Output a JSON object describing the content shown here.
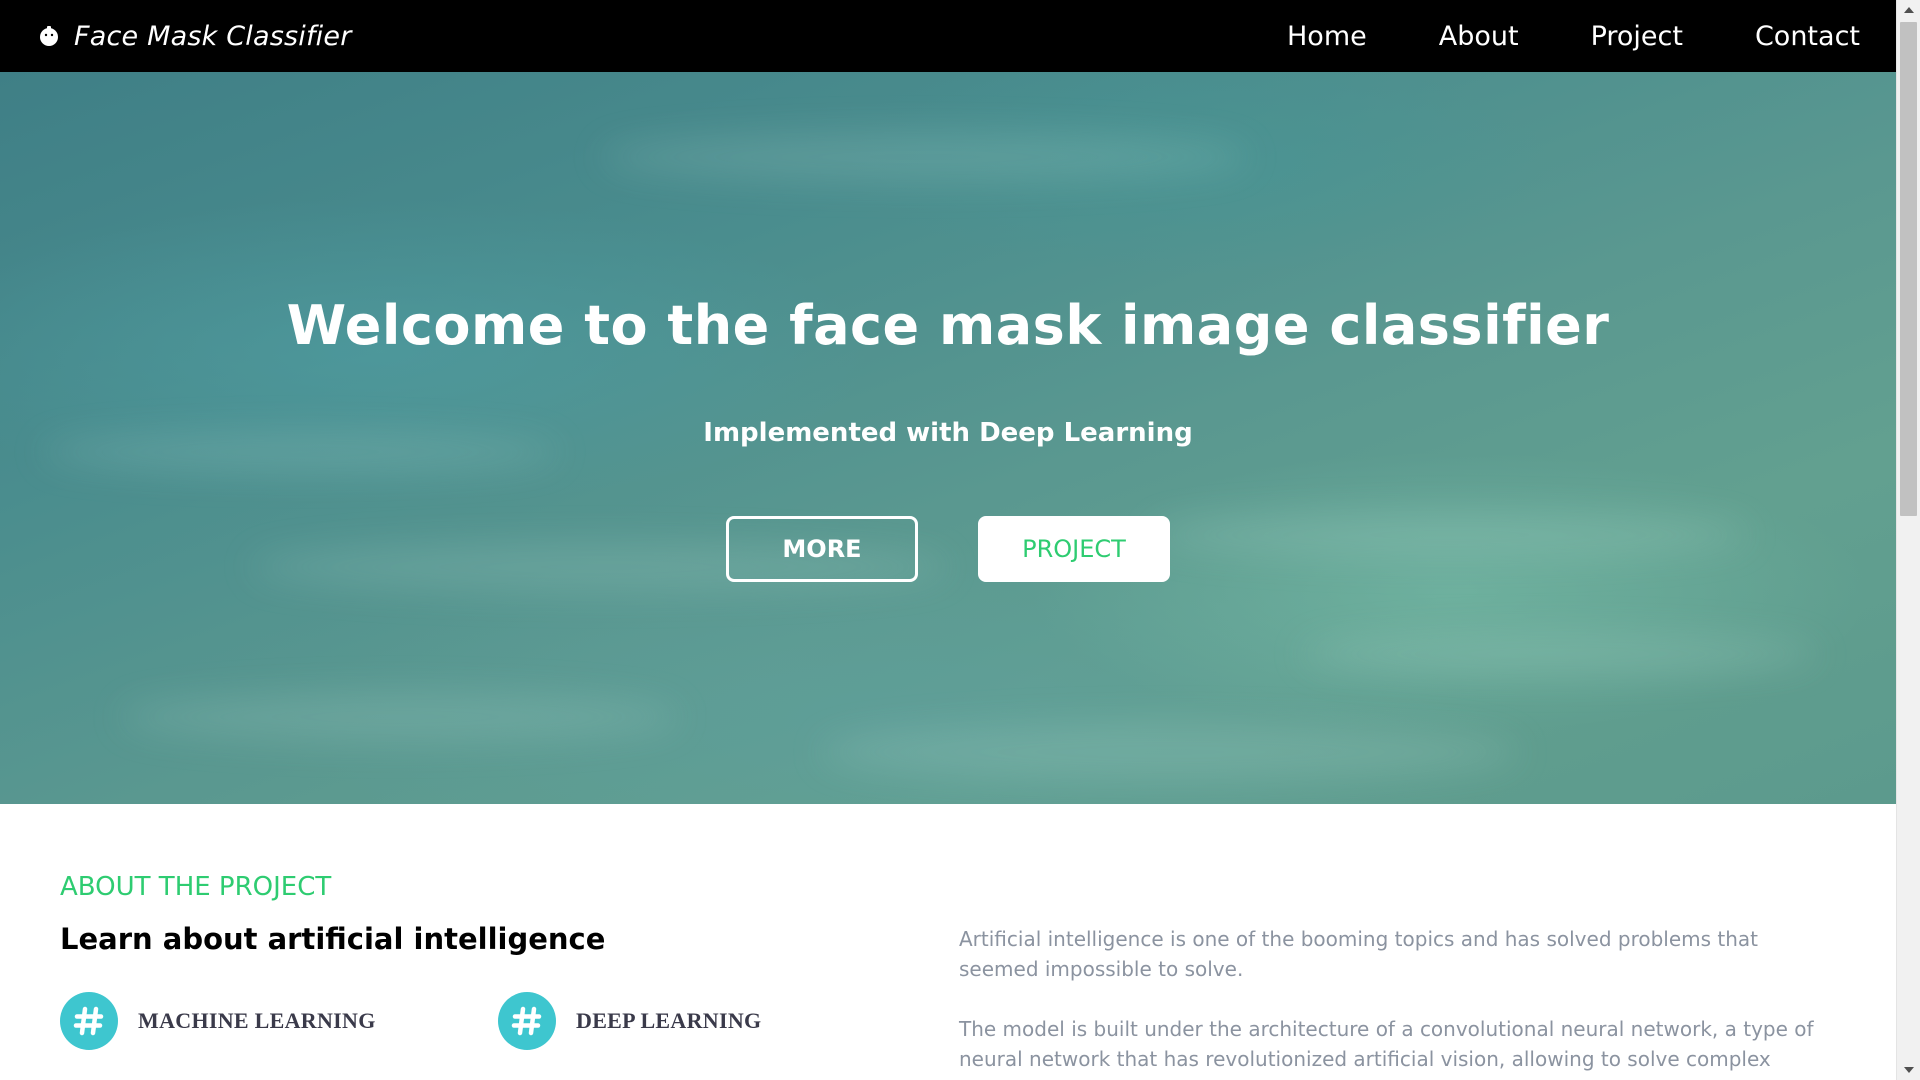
{
  "navbar": {
    "brand": "Face Mask Classifier",
    "brand_icon": "face-mask-icon",
    "links": [
      "Home",
      "About",
      "Project",
      "Contact"
    ]
  },
  "hero": {
    "title": "Welcome to the face mask image classifier",
    "subtitle": "Implemented with Deep Learning",
    "buttons": {
      "more": "MORE",
      "project": "PROJECT"
    }
  },
  "about": {
    "eyebrow": "ABOUT THE PROJECT",
    "heading": "Learn about artificial intelligence",
    "features": [
      {
        "label": "MACHINE LEARNING",
        "icon": "hashtag-icon"
      },
      {
        "label": "DEEP LEARNING",
        "icon": "hashtag-icon"
      }
    ],
    "paragraphs": [
      "Artificial intelligence is one of the booming topics and has solved problems that seemed impossible to solve.",
      "The model is built under the architecture of a convolutional neural network, a type of neural network that has revolutionized artificial vision, allowing to solve complex problems such as"
    ]
  },
  "colors": {
    "accent_green": "#2ecc71",
    "icon_teal": "#3ec6cf",
    "navbar_bg": "#000000",
    "body_text_gray": "#8b93a0"
  }
}
